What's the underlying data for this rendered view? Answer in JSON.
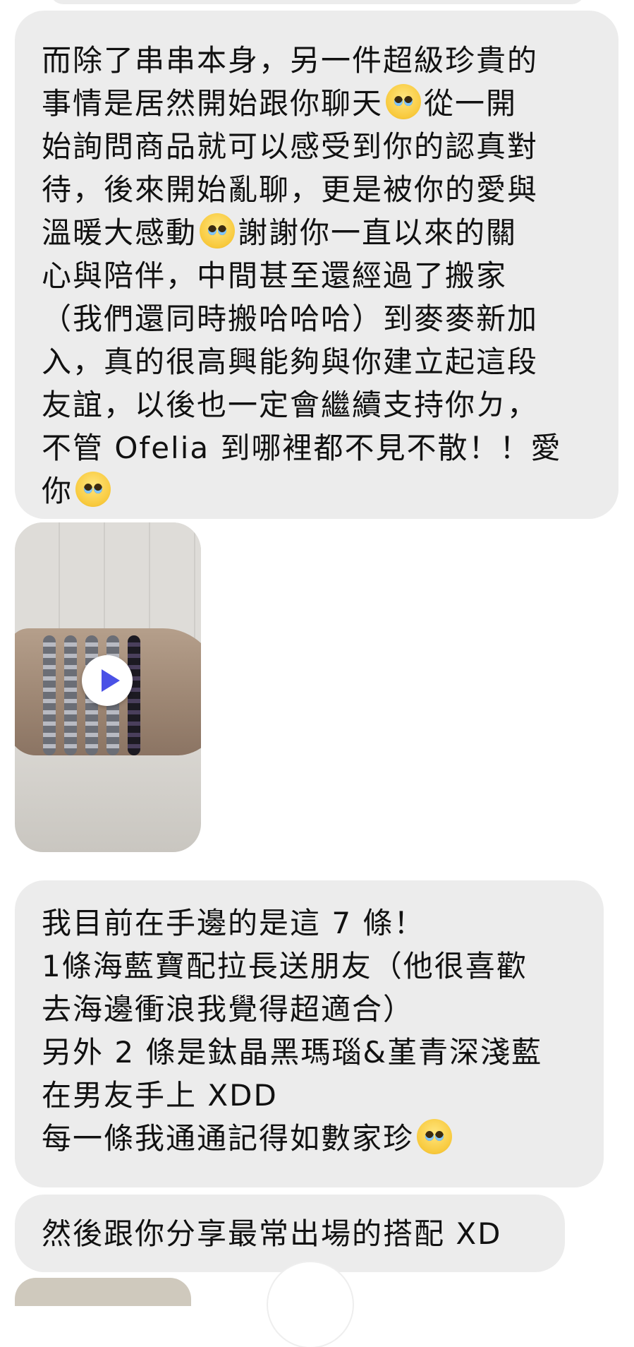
{
  "messages": {
    "m1": {
      "line1": "而除了串串本身，另一件超級珍貴的",
      "line2a": "事情是居然開始跟你聊天",
      "line2b": "從一開",
      "line3": "始詢問商品就可以感受到你的認真對",
      "line4": "待，後來開始亂聊，更是被你的愛與",
      "line5a": "溫暖大感動",
      "line5b": "謝謝你一直以來的關",
      "line6": "心與陪伴，中間甚至還經過了搬家",
      "line7": "（我們還同時搬哈哈哈）到麥麥新加",
      "line8": "入，真的很高興能夠與你建立起這段",
      "line9": "友誼，以後也一定會繼續支持你ㄉ，",
      "line10": "不管 Ofelia 到哪裡都不見不散！！愛",
      "line11": "你"
    },
    "m2": {
      "line1": "我目前在手邊的是這 7 條！",
      "line2": "1條海藍寶配拉長送朋友（他很喜歡",
      "line3": "去海邊衝浪我覺得超適合）",
      "line4": "另外 2 條是鈦晶黑瑪瑙&堇青深淺藍",
      "line5": "在男友手上 XDD",
      "line6": "每一條我通通記得如數家珍"
    },
    "m3": {
      "line1": "然後跟你分享最常出場的搭配 XD"
    }
  },
  "icons": {
    "pleading": "pleading-face-emoji",
    "smiling_hearts": "smiling-face-with-hearts-emoji",
    "play": "play-icon"
  },
  "colors": {
    "bubble": "#ececec",
    "play": "#4a51e6",
    "text": "#111111"
  }
}
